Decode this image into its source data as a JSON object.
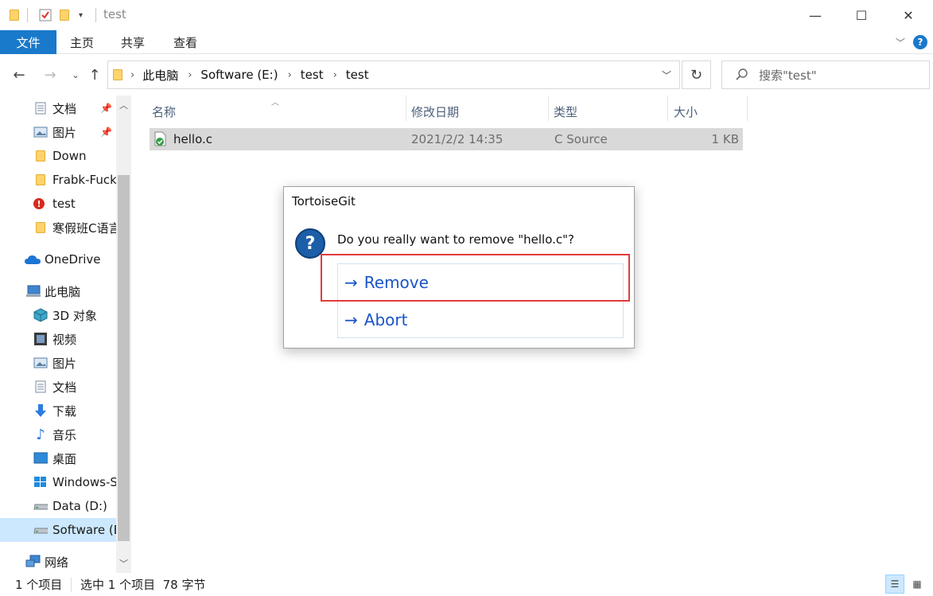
{
  "window": {
    "title": "test",
    "minimize_glyph": "—",
    "maximize_glyph": "☐",
    "close_glyph": "✕"
  },
  "ribbon": {
    "file_tab": "文件",
    "tabs": [
      "主页",
      "共享",
      "查看"
    ],
    "help_glyph": "?"
  },
  "nav": {
    "breadcrumbs": [
      "此电脑",
      "Software (E:)",
      "test",
      "test"
    ],
    "search_placeholder": "搜索\"test\""
  },
  "sidebar": {
    "items": [
      {
        "label": "文档",
        "icon": "documents-icon",
        "pinned": true
      },
      {
        "label": "图片",
        "icon": "pictures-icon",
        "pinned": true
      },
      {
        "label": "Down",
        "icon": "folder-icon"
      },
      {
        "label": "Frabk-Fuck",
        "icon": "folder-icon"
      },
      {
        "label": "test",
        "icon": "git-conflict-folder-icon"
      },
      {
        "label": "寒假班C语言",
        "icon": "folder-icon"
      },
      {
        "label": "OneDrive",
        "icon": "onedrive-icon"
      },
      {
        "label": "此电脑",
        "icon": "this-pc-icon"
      },
      {
        "label": "3D 对象",
        "icon": "3d-objects-icon"
      },
      {
        "label": "视频",
        "icon": "videos-icon"
      },
      {
        "label": "图片",
        "icon": "pictures-icon"
      },
      {
        "label": "文档",
        "icon": "documents-icon"
      },
      {
        "label": "下载",
        "icon": "downloads-icon"
      },
      {
        "label": "音乐",
        "icon": "music-icon"
      },
      {
        "label": "桌面",
        "icon": "desktop-icon"
      },
      {
        "label": "Windows-SSD",
        "icon": "windows-drive-icon"
      },
      {
        "label": "Data (D:)",
        "icon": "drive-icon"
      },
      {
        "label": "Software (E:)",
        "icon": "drive-icon",
        "selected": true
      },
      {
        "label": "网络",
        "icon": "network-icon"
      }
    ]
  },
  "columns": {
    "name": "名称",
    "modified": "修改日期",
    "type": "类型",
    "size": "大小"
  },
  "files": [
    {
      "name": "hello.c",
      "modified": "2021/2/2 14:35",
      "type": "C Source",
      "size": "1 KB",
      "icon": "git-added-file-icon"
    }
  ],
  "dialog": {
    "title": "TortoiseGit",
    "message": "Do you really want to remove \"hello.c\"?",
    "icon": "question-icon",
    "buttons": {
      "remove": "Remove",
      "abort": "Abort"
    },
    "arrow_glyph": "→",
    "highlight_color": "#e23b3b"
  },
  "status": {
    "item_count": "1 个项目",
    "selected": "选中 1 个项目  78 字节"
  },
  "colors": {
    "accent": "#1979ca",
    "selection": "#cce8ff",
    "command_link": "#1a54c8"
  }
}
